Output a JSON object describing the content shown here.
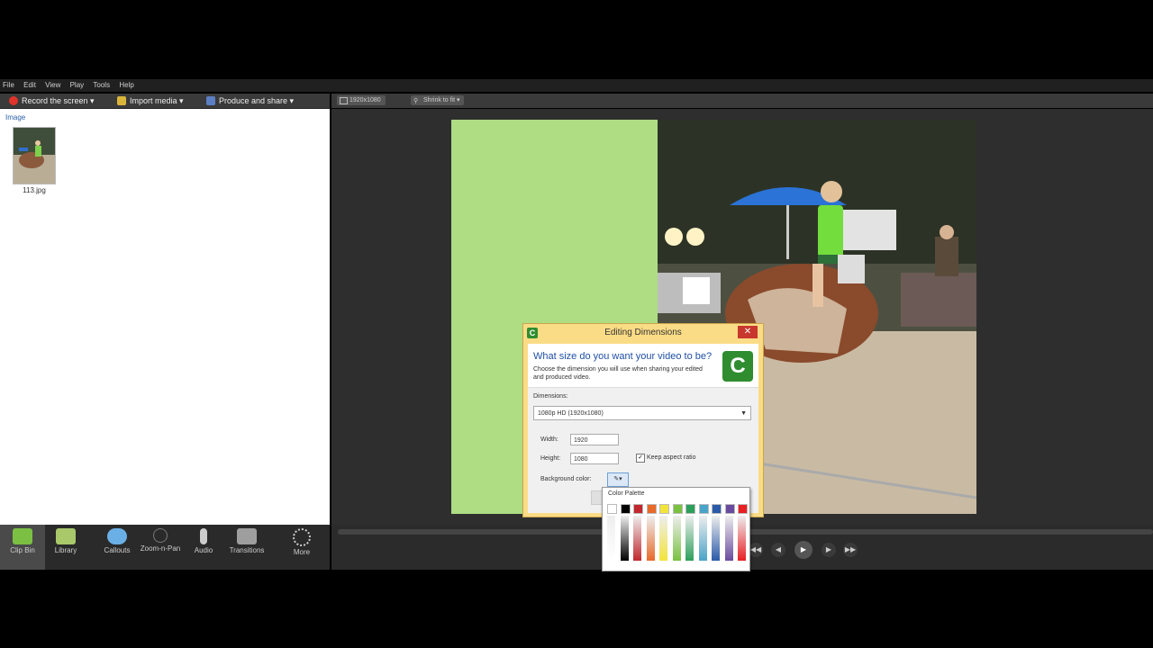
{
  "menu": [
    "File",
    "Edit",
    "View",
    "Play",
    "Tools",
    "Help"
  ],
  "toolbar": {
    "record": "Record the screen ▾",
    "import": "Import media ▾",
    "produce": "Produce and share ▾"
  },
  "preview_toolbar": {
    "dimensions": "1920x1080",
    "zoom": "Shrink to fit"
  },
  "clip_bin": {
    "section_label": "Image",
    "item_name": "113.jpg"
  },
  "tabs": [
    {
      "label": "Clip Bin",
      "icon": "film-icon",
      "color": "#7bc043"
    },
    {
      "label": "Library",
      "icon": "library-icon",
      "color": "#a8c86a"
    },
    {
      "label": "Callouts",
      "icon": "speech-bubble-icon",
      "color": "#6ab0e6"
    },
    {
      "label": "Zoom-n-Pan",
      "icon": "magnifier-icon",
      "color": "#888888"
    },
    {
      "label": "Audio",
      "icon": "microphone-icon",
      "color": "#cccccc"
    },
    {
      "label": "Transitions",
      "icon": "transitions-icon",
      "color": "#bbbbbb"
    },
    {
      "label": "More",
      "icon": "more-dots-icon",
      "color": "#cccccc"
    }
  ],
  "dialog": {
    "title": "Editing Dimensions",
    "heading": "What size do you want your video to be?",
    "subtitle": "Choose the dimension you will use when sharing your edited and produced video.",
    "dimensions_label": "Dimensions:",
    "dimensions_value": "1080p HD (1920x1080)",
    "width_label": "Width:",
    "width_value": "1920",
    "height_label": "Height:",
    "height_value": "1080",
    "keep_aspect_label": "Keep aspect ratio",
    "keep_aspect_checked": true,
    "background_color_label": "Background color:"
  },
  "palette": {
    "title": "Color Palette",
    "columns": [
      "#ffffff",
      "#000000",
      "#c0282d",
      "#e86a2a",
      "#f2e43a",
      "#7ac142",
      "#2ca05a",
      "#4aa3c8",
      "#2b5aa8",
      "#6a4b9e",
      "#e82024"
    ]
  },
  "colors": {
    "canvas_bg": "#aedd84",
    "dialog_frame": "#fbdc86",
    "accent_green": "#2f8d2f",
    "link_blue": "#1f4fa5"
  }
}
